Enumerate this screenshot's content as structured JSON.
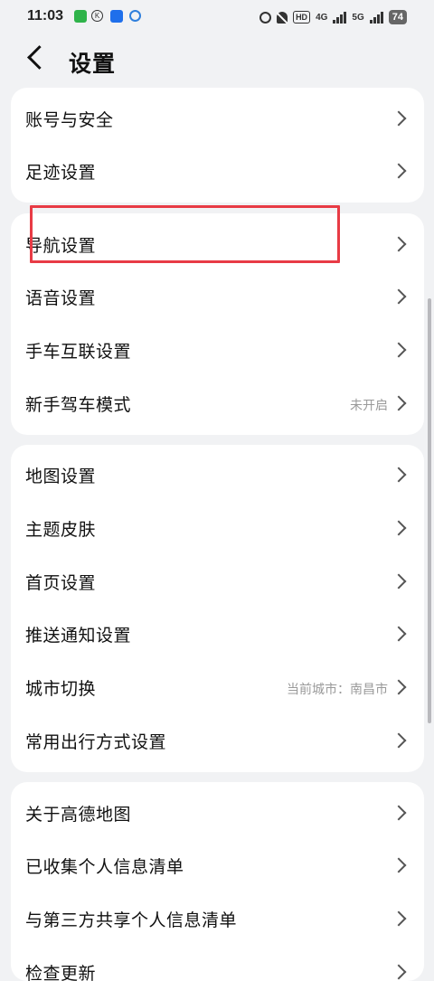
{
  "status": {
    "time": "11:03",
    "right": {
      "hd": "HD",
      "hd_sub": "1 2",
      "net1": "4G",
      "net2": "5G",
      "battery": "74"
    }
  },
  "header": {
    "title": "设置"
  },
  "groups": [
    {
      "items": [
        {
          "label": "账号与安全"
        },
        {
          "label": "足迹设置"
        }
      ]
    },
    {
      "items": [
        {
          "label": "导航设置"
        },
        {
          "label": "语音设置"
        },
        {
          "label": "手车互联设置"
        },
        {
          "label": "新手驾车模式",
          "value": "未开启"
        }
      ]
    },
    {
      "items": [
        {
          "label": "地图设置"
        },
        {
          "label": "主题皮肤"
        },
        {
          "label": "首页设置"
        },
        {
          "label": "推送通知设置"
        },
        {
          "label": "城市切换",
          "value": "当前城市：南昌市"
        },
        {
          "label": "常用出行方式设置"
        }
      ]
    },
    {
      "items": [
        {
          "label": "关于高德地图"
        },
        {
          "label": "已收集个人信息清单"
        },
        {
          "label": "与第三方共享个人信息清单"
        },
        {
          "label": "检查更新"
        }
      ]
    }
  ]
}
